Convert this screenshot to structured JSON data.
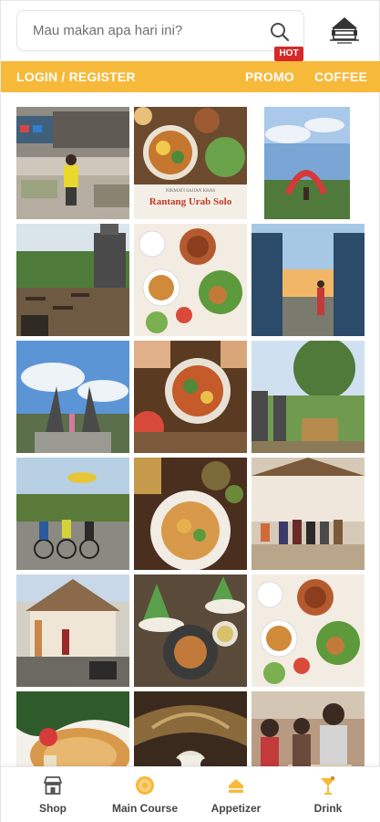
{
  "search": {
    "placeholder": "Mau makan apa hari ini?"
  },
  "badge": {
    "hot": "HOT"
  },
  "brand": {
    "accent": "#f7b93a",
    "hot_color": "#d62828"
  },
  "nav": {
    "login": "LOGIN / REGISTER",
    "promo": "PROMO",
    "coffee": "COFFEE"
  },
  "grid": {
    "tiles": [
      {
        "subject": "cafe terrace with woman in yellow"
      },
      {
        "subject": "food collage",
        "caption_small": "NIKMATI SAJIAN KHAS",
        "caption": "Rantang Urab Solo"
      },
      {
        "subject": "flower arch garden"
      },
      {
        "subject": "outdoor dining hillside"
      },
      {
        "subject": "traditional dishes with terracotta pots"
      },
      {
        "subject": "temple gate at sunset"
      },
      {
        "subject": "split gate under blue sky"
      },
      {
        "subject": "hands holding bowl of soup"
      },
      {
        "subject": "garden with gate statue"
      },
      {
        "subject": "cyclists group"
      },
      {
        "subject": "noodle plate"
      },
      {
        "subject": "group photo at hall"
      },
      {
        "subject": "joglo house"
      },
      {
        "subject": "tumpeng rice platter"
      },
      {
        "subject": "traditional dishes spread"
      },
      {
        "subject": "fried dish on leaf"
      },
      {
        "subject": "rice dish with decoration"
      },
      {
        "subject": "people serving food"
      }
    ]
  },
  "tabs": [
    {
      "label": "Shop",
      "icon": "shop-icon"
    },
    {
      "label": "Main Course",
      "icon": "plate-icon"
    },
    {
      "label": "Appetizer",
      "icon": "cake-icon"
    },
    {
      "label": "Drink",
      "icon": "cocktail-icon"
    }
  ]
}
